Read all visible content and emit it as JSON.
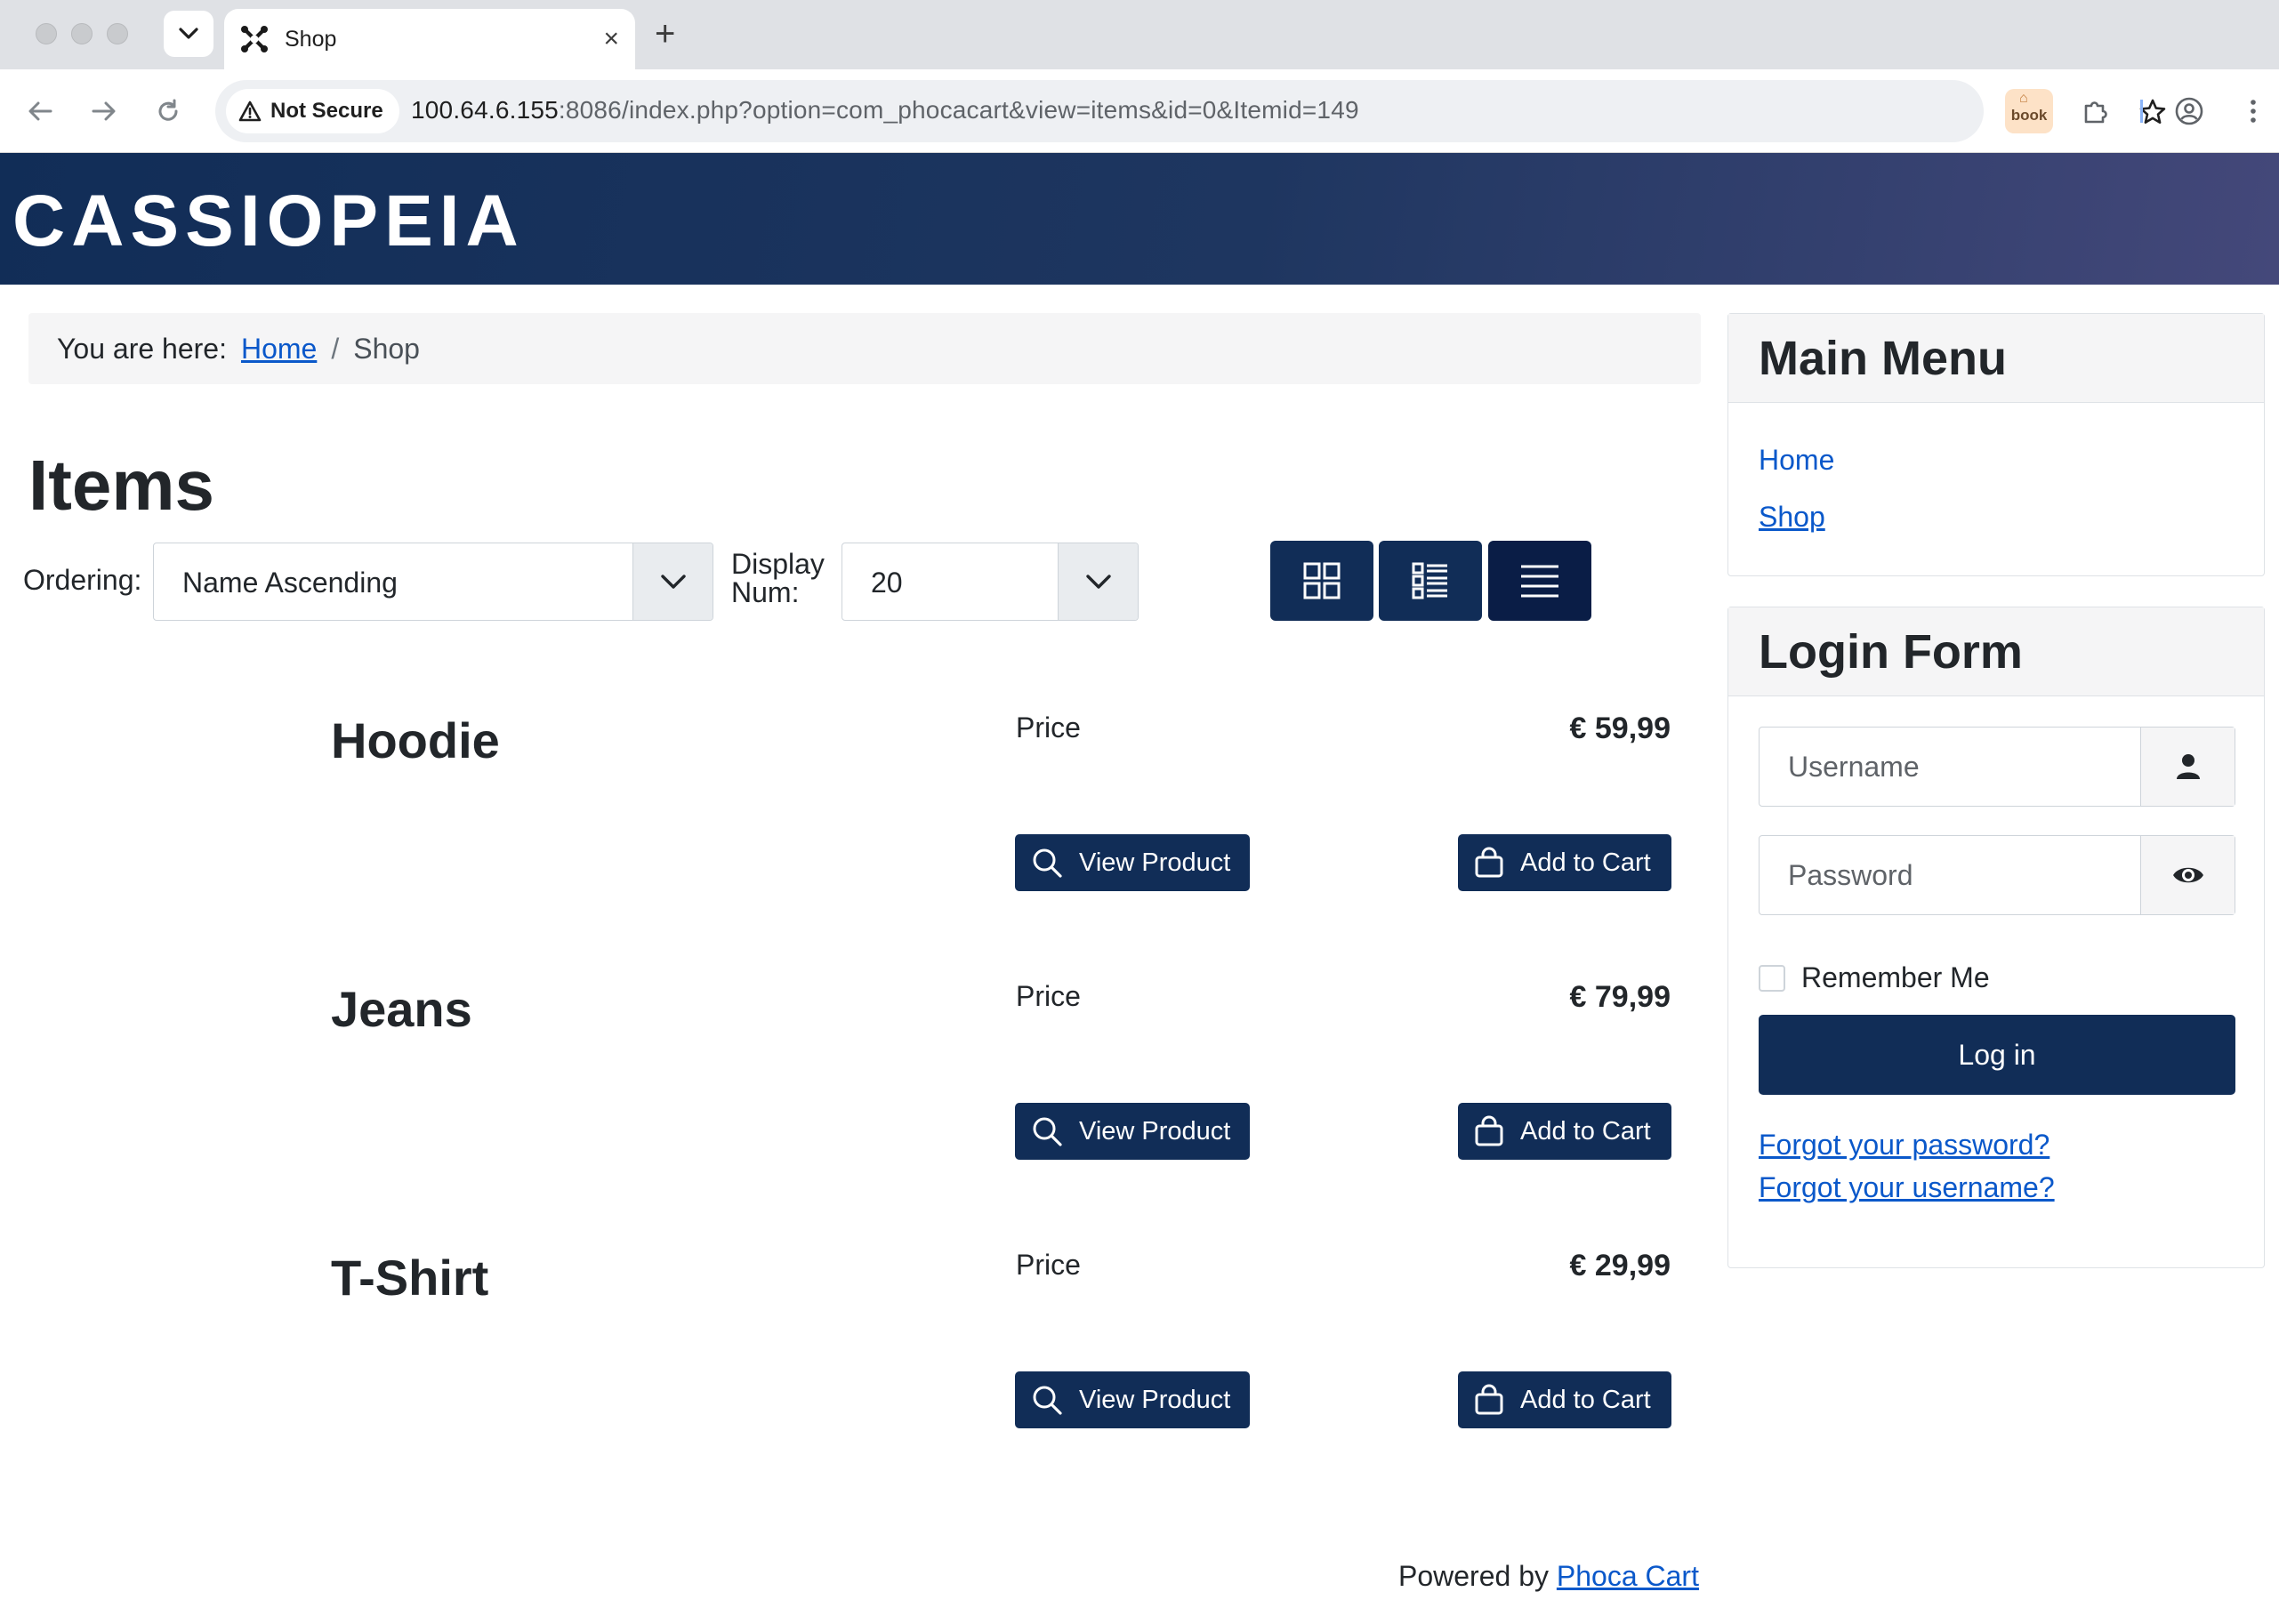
{
  "browser": {
    "tab_title": "Shop",
    "new_tab_label": "+",
    "security_label": "Not Secure",
    "url_host": "100.64.6.155",
    "url_rest": ":8086/index.php?option=com_phocacart&view=items&id=0&Itemid=149",
    "extension_label": "book"
  },
  "site": {
    "brand": "CASSIOPEIA"
  },
  "breadcrumb": {
    "prefix": "You are here:",
    "home": "Home",
    "separator": "/",
    "current": "Shop"
  },
  "page": {
    "title": "Items"
  },
  "controls": {
    "ordering_label": "Ordering:",
    "ordering_value": "Name Ascending",
    "display_label_1": "Display",
    "display_label_2": "Num:",
    "display_value": "20",
    "view_modes": [
      "grid",
      "grid-list",
      "list"
    ],
    "active_view": "list"
  },
  "products": [
    {
      "name": "Hoodie",
      "price_label": "Price",
      "price": "€ 59,99",
      "view_label": "View Product",
      "cart_label": "Add to Cart"
    },
    {
      "name": "Jeans",
      "price_label": "Price",
      "price": "€ 79,99",
      "view_label": "View Product",
      "cart_label": "Add to Cart"
    },
    {
      "name": "T-Shirt",
      "price_label": "Price",
      "price": "€ 29,99",
      "view_label": "View Product",
      "cart_label": "Add to Cart"
    }
  ],
  "footer": {
    "powered_by": "Powered by",
    "powered_link": "Phoca Cart"
  },
  "sidebar": {
    "main_menu": {
      "title": "Main Menu",
      "items": [
        "Home",
        "Shop"
      ]
    },
    "login": {
      "title": "Login Form",
      "username_placeholder": "Username",
      "password_placeholder": "Password",
      "remember_label": "Remember Me",
      "login_button": "Log in",
      "forgot_password": "Forgot your password?",
      "forgot_username": "Forgot your username?"
    }
  },
  "colors": {
    "primary": "#112d57",
    "primary_active": "#0a1d46",
    "link": "#0a58ca",
    "text": "#22262a"
  },
  "icons": {
    "tab_favicon": "joomla-icon",
    "search_action": "search-icon",
    "cart_action": "shopping-bag-icon",
    "username_addon": "user-icon",
    "password_addon": "eye-icon"
  }
}
